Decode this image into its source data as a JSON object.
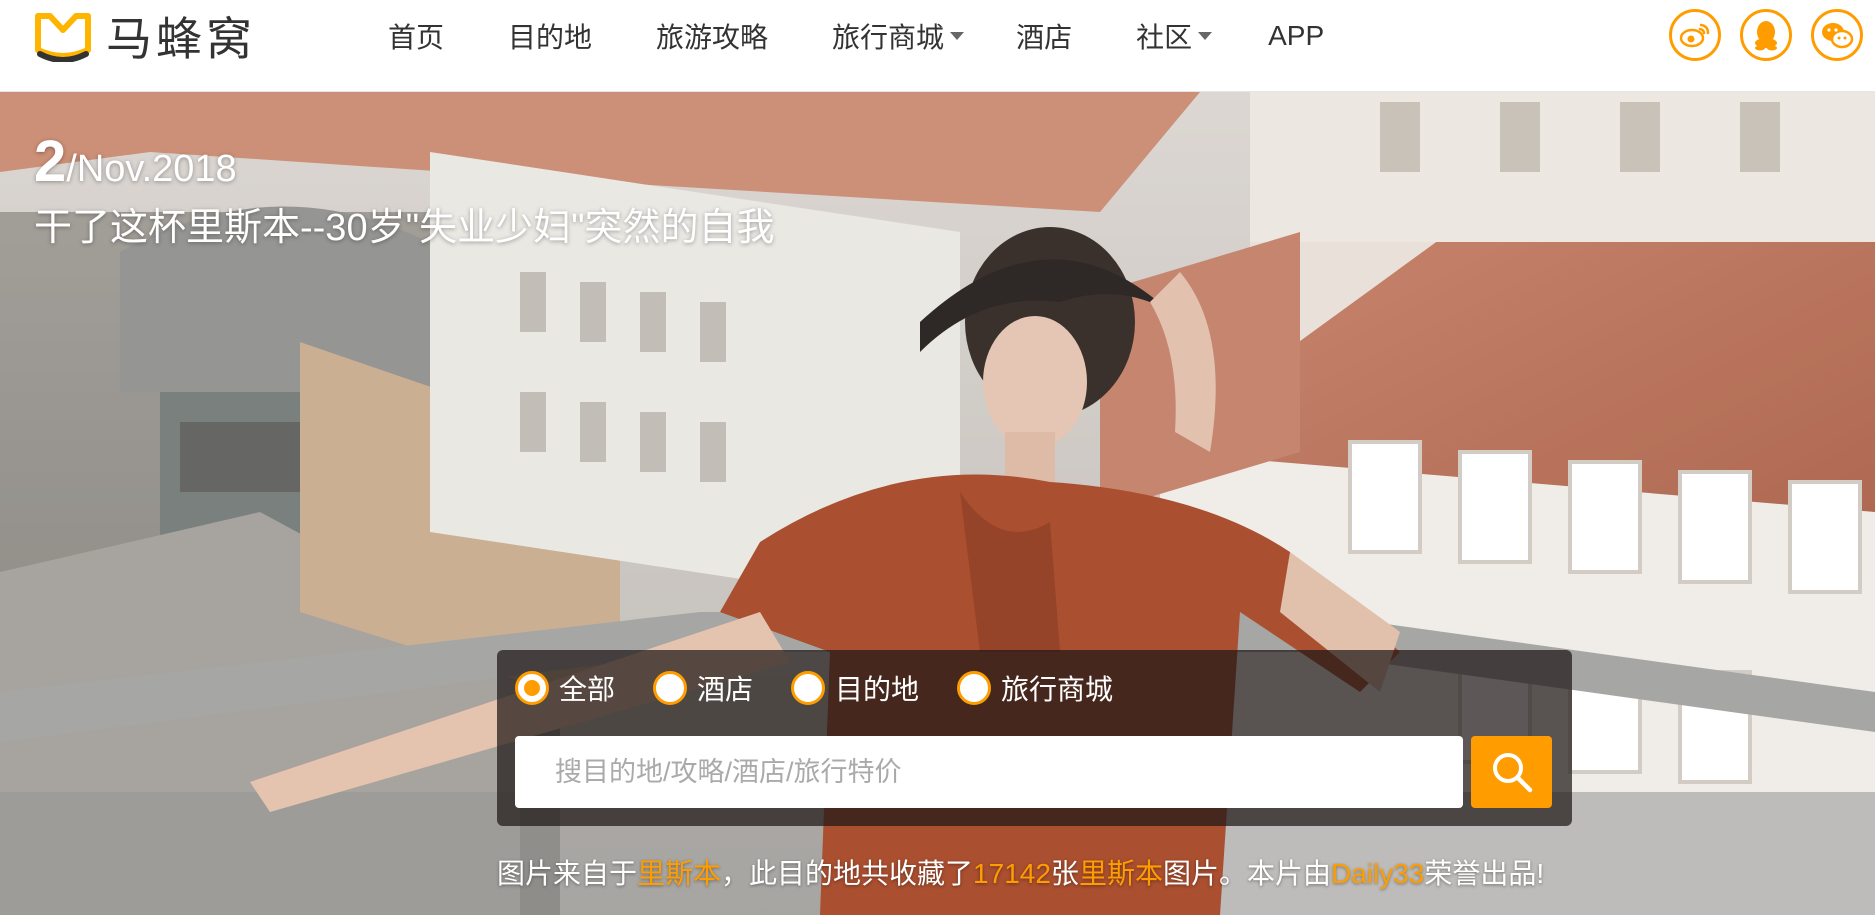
{
  "header": {
    "logo_text": "马蜂窝",
    "nav": [
      {
        "label": "首页",
        "has_dropdown": false
      },
      {
        "label": "目的地",
        "has_dropdown": false
      },
      {
        "label": "旅游攻略",
        "has_dropdown": false
      },
      {
        "label": "旅行商城",
        "has_dropdown": true
      },
      {
        "label": "酒店",
        "has_dropdown": false
      },
      {
        "label": "社区",
        "has_dropdown": true
      },
      {
        "label": "APP",
        "has_dropdown": false
      }
    ],
    "social_icons": [
      "weibo-icon",
      "qq-icon",
      "wechat-icon"
    ]
  },
  "hero": {
    "date_day": "2",
    "date_rest": "/Nov.2018",
    "title": "干了这杯里斯本--30岁\"失业少妇\"突然的自我"
  },
  "search": {
    "options": [
      {
        "label": "全部",
        "checked": true
      },
      {
        "label": "酒店",
        "checked": false
      },
      {
        "label": "目的地",
        "checked": false
      },
      {
        "label": "旅行商城",
        "checked": false
      }
    ],
    "placeholder": "搜目的地/攻略/酒店/旅行特价"
  },
  "credit": {
    "part1": "图片来自于",
    "place": "里斯本",
    "part2": "，此目的地共收藏了",
    "count": "17142",
    "part3": "张",
    "place2": "里斯本",
    "part4": "图片。本片由",
    "author": "Daily33",
    "part5": "荣誉出品!"
  },
  "colors": {
    "accent": "#ff9d00",
    "logo_yellow": "#ffb400"
  }
}
